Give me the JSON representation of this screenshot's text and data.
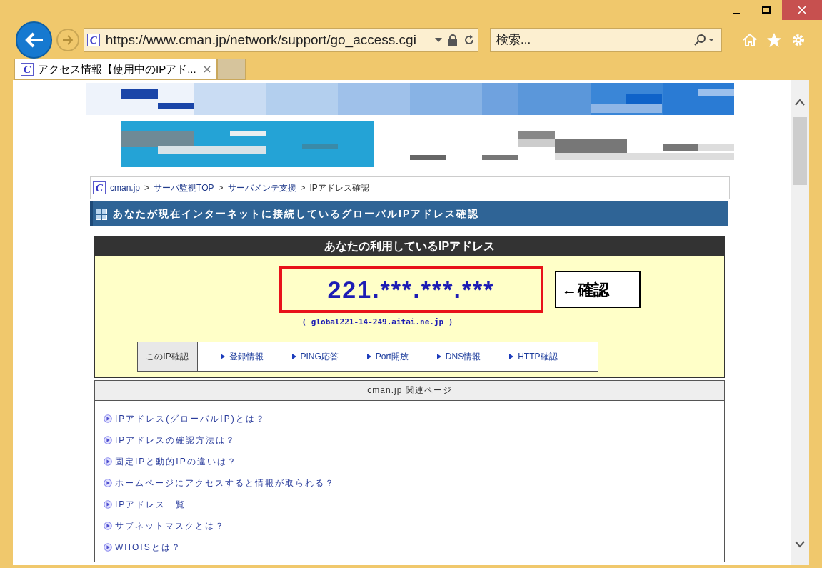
{
  "address_bar": {
    "site_icon": "C",
    "url": "https://www.cman.jp/network/support/go_access.cgi"
  },
  "search": {
    "placeholder": "検索..."
  },
  "tabs": [
    {
      "site_icon": "C",
      "label": "アクセス情報【使用中のIPアド...",
      "selected": true
    }
  ],
  "breadcrumb": {
    "site_icon": "C",
    "separator": ">",
    "items": [
      "cman.jp",
      "サーバ監視TOP",
      "サーバメンテ支援",
      "IPアドレス確認"
    ]
  },
  "page_heading": "あなたが現在インターネットに接続しているグローバルIPアドレス確認",
  "ip_panel": {
    "title": "あなたの利用しているIPアドレス",
    "ip": "221.***.***.***",
    "annotation": "←確認",
    "hostname": "( global221-14-249.aitai.ne.jp )",
    "tools_label": "このIP確認",
    "tools": [
      "登録情報",
      "PING応答",
      "Port開放",
      "DNS情報",
      "HTTP確認"
    ]
  },
  "related": {
    "title": "cman.jp 関連ページ",
    "links": [
      "IPアドレス(グローバルIP)とは？",
      "IPアドレスの確認方法は？",
      "固定IPと動的IPの違いは？",
      "ホームページにアクセスすると情報が取られる？",
      "IPアドレス一覧",
      "サブネットマスクとは？",
      "WHOISとは？"
    ]
  }
}
